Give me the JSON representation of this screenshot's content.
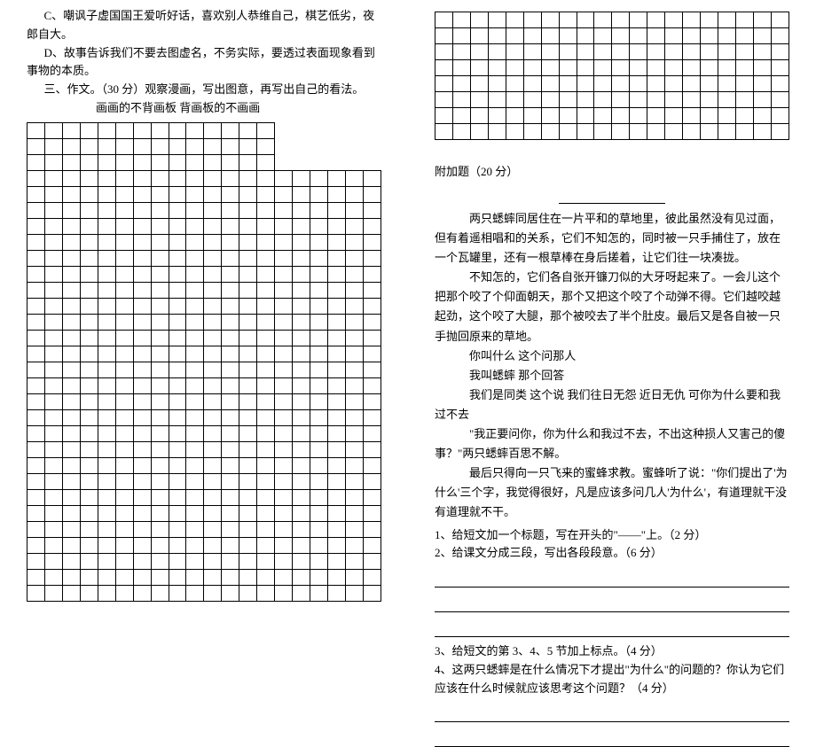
{
  "left": {
    "optionC": "C、嘲讽子虚国国王爱听好话，喜欢别人恭维自己，棋艺低劣，夜郎自大。",
    "optionD": "D、故事告诉我们不要去图虚名，不务实际，要透过表面现象看到事物的本质。",
    "sectionThree": "三、作文。（30 分）观察漫画，写出图意，再写出自己的看法。",
    "essayCaption": "画画的不背画板    背画板的不画画",
    "mainGrid": {
      "rows": 30,
      "cols": 20
    }
  },
  "right": {
    "topGrid": {
      "rows": 8,
      "cols": 20
    },
    "bonusTitle": "附加题（20 分）",
    "passage": {
      "p1": "两只蟋蟀同居住在一片平和的草地里，彼此虽然没有见过面，但有着遥相唱和的关系，它们不知怎的，同时被一只手捕住了，放在一个瓦罐里，还有一根草棒在身后搓着，让它们往一块凑拢。",
      "p2": "不知怎的，它们各自张开镰刀似的大牙呀起来了。一会儿这个把那个咬了个仰面朝天，那个又把这个咬了个动弹不得。它们越咬越起劲，这个咬了大腿，那个被咬去了半个肚皮。最后又是各自被一只手抛回原来的草地。",
      "p3": "你叫什么    这个问那人",
      "p4": "我叫蟋蟀    那个回答",
      "p5": "我们是同类    这个说    我们往日无怨    近日无仇    可你为什么要和我过不去",
      "p6": "\"我正要问你，你为什么和我过不去，不出这种损人又害己的傻事？\"两只蟋蟀百思不解。",
      "p7": "最后只得向一只飞来的蜜蜂求教。蜜蜂听了说：\"你们提出了'为什么'三个字，我觉得很好，凡是应该多问几人'为什么'，有道理就干没有道理就不干。"
    },
    "q1": "1、给短文加一个标题，写在开头的\"——\"上。（2 分）",
    "q2": "2、给课文分成三段，写出各段段意。（6 分）",
    "q3": "3、给短文的第 3、4、5 节加上标点。（4 分）",
    "q4": "4、这两只蟋蟀是在什么情况下才提出\"为什么\"的问题的？你认为它们应该在什么时候就应该思考这个问题？（4 分）"
  }
}
